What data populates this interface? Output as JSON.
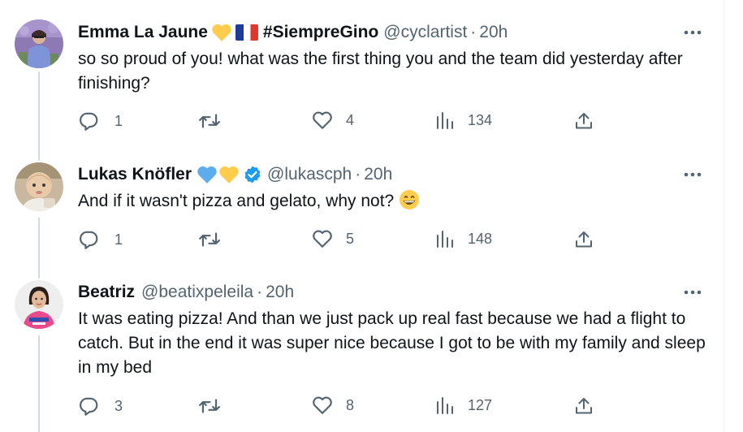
{
  "tweets": [
    {
      "name": "Emma La Jaune",
      "name_extra": "#SiempreGino",
      "handle": "@cyclartist",
      "sep": "·",
      "time": "20h",
      "text": "so so proud of you! what was the first thing you and the team did yesterday after finishing?",
      "replies": "1",
      "retweets": "",
      "likes": "4",
      "views": "134",
      "badges": [
        "yellow-heart",
        "france-flag"
      ]
    },
    {
      "name": "Lukas Knöfler",
      "handle": "@lukascph",
      "sep": "·",
      "time": "20h",
      "text": "And if it wasn't pizza and gelato, why not?",
      "emoji": "grinning-face-emoji",
      "replies": "1",
      "retweets": "",
      "likes": "5",
      "views": "148",
      "badges": [
        "blue-heart",
        "yellow-heart",
        "verified-check"
      ]
    },
    {
      "name": "Beatriz",
      "handle": "@beatixpeleila",
      "sep": "·",
      "time": "20h",
      "text": "It was eating pizza! And than we just pack up real fast because we had a flight to catch. But in the end it was super nice because I got to be with my family and sleep in my bed",
      "replies": "3",
      "retweets": "",
      "likes": "8",
      "views": "127",
      "badges": []
    }
  ],
  "colors": {
    "text": "#0f1419",
    "secondary": "#536471",
    "thread_line": "#cfd9de",
    "verified": "#1d9bf0",
    "yellow_heart": "#ffcc4d",
    "blue_heart": "#5dadec"
  }
}
